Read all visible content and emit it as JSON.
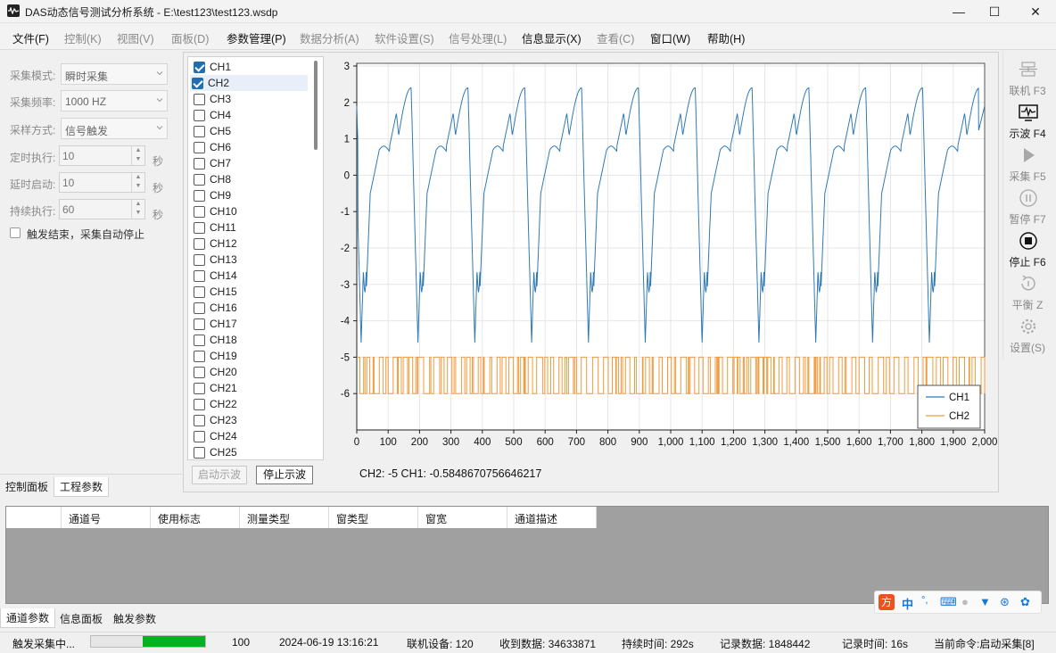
{
  "window": {
    "title": "DAS动态信号测试分析系统 - E:\\test123\\test123.wsdp",
    "minimize": "—",
    "maximize": "☐",
    "close": "✕"
  },
  "menu": [
    {
      "label": "文件(F)",
      "enabled": true
    },
    {
      "label": "控制(K)",
      "enabled": false
    },
    {
      "label": "视图(V)",
      "enabled": false
    },
    {
      "label": "面板(D)",
      "enabled": false
    },
    {
      "label": "参数管理(P)",
      "enabled": true
    },
    {
      "label": "数据分析(A)",
      "enabled": false
    },
    {
      "label": "软件设置(S)",
      "enabled": false
    },
    {
      "label": "信号处理(L)",
      "enabled": false
    },
    {
      "label": "信息显示(X)",
      "enabled": true
    },
    {
      "label": "查看(C)",
      "enabled": false
    },
    {
      "label": "窗口(W)",
      "enabled": true
    },
    {
      "label": "帮助(H)",
      "enabled": true
    }
  ],
  "control_panel": {
    "mode_label": "采集模式:",
    "mode_value": "瞬时采集",
    "freq_label": "采集频率:",
    "freq_value": "1000 HZ",
    "sample_label": "采样方式:",
    "sample_value": "信号触发",
    "timed_label": "定时执行:",
    "timed_value": "10",
    "delay_label": "延时启动:",
    "delay_value": "10",
    "duration_label": "持续执行:",
    "duration_value": "60",
    "unit": "秒",
    "auto_stop_label": "触发结束，采集自动停止"
  },
  "left_tabs": [
    "控制面板",
    "工程参数"
  ],
  "channels": [
    "CH1",
    "CH2",
    "CH3",
    "CH4",
    "CH5",
    "CH6",
    "CH7",
    "CH8",
    "CH9",
    "CH10",
    "CH11",
    "CH12",
    "CH13",
    "CH14",
    "CH15",
    "CH16",
    "CH17",
    "CH18",
    "CH19",
    "CH20",
    "CH21",
    "CH22",
    "CH23",
    "CH24",
    "CH25"
  ],
  "channels_checked": [
    "CH1",
    "CH2"
  ],
  "buttons": {
    "start_wave": "启动示波",
    "stop_wave": "停止示波"
  },
  "chart_status": "CH2: -5 CH1: -0.5848670756646217",
  "chart_data": {
    "type": "line",
    "xlim": [
      0,
      2000
    ],
    "ylim": [
      -7,
      3
    ],
    "x_ticks": [
      "0",
      "100",
      "200",
      "300",
      "400",
      "500",
      "600",
      "700",
      "800",
      "900",
      "1,000",
      "1,100",
      "1,200",
      "1,300",
      "1,400",
      "1,500",
      "1,600",
      "1,700",
      "1,800",
      "1,900",
      "2,000"
    ],
    "y_ticks": [
      "3",
      "2",
      "1",
      "0",
      "-1",
      "-2",
      "-3",
      "-4",
      "-5",
      "-6"
    ],
    "grid": true,
    "legend_position": "bottom-right",
    "series": [
      {
        "name": "CH1",
        "color": "#2f7ab5",
        "period": 181,
        "peaks_x": [
          195,
          376,
          557,
          738,
          919,
          1100,
          1281,
          1462,
          1643,
          1824
        ],
        "peak_value": 2.5,
        "trough_value": -4.8,
        "end_value": 1.9
      },
      {
        "name": "CH2",
        "color": "#f29a3c",
        "levels": [
          -5,
          -6
        ]
      }
    ]
  },
  "right_tools": [
    {
      "label": "联机 F3",
      "icon": "network-icon",
      "enabled": false
    },
    {
      "label": "示波 F4",
      "icon": "waveform-icon",
      "enabled": true
    },
    {
      "label": "采集 F5",
      "icon": "play-icon",
      "enabled": false
    },
    {
      "label": "暂停 F7",
      "icon": "pause-icon",
      "enabled": false
    },
    {
      "label": "停止 F6",
      "icon": "stop-icon",
      "enabled": true
    },
    {
      "label": "平衡 Z",
      "icon": "balance-icon",
      "enabled": false
    },
    {
      "label": "设置(S)",
      "icon": "gear-icon",
      "enabled": false
    }
  ],
  "param_table": {
    "columns": [
      "",
      "通道号",
      "使用标志",
      "测量类型",
      "窗类型",
      "窗宽",
      "通道描述"
    ]
  },
  "bottom_tabs": [
    "通道参数",
    "信息面板",
    "触发参数"
  ],
  "ime": {
    "logo": "方",
    "lang": "中"
  },
  "status": {
    "state": "触发采集中...",
    "progress_percent": 55,
    "progress_value": "100",
    "datetime": "2024-06-19 13:16:21",
    "connected": "联机设备: 120",
    "received": "收到数据: 34633871",
    "duration": "持续时间: 292s",
    "records": "记录数据: 1848442",
    "record_time": "记录时间: 16s",
    "command": "当前命令:启动采集[8]"
  }
}
